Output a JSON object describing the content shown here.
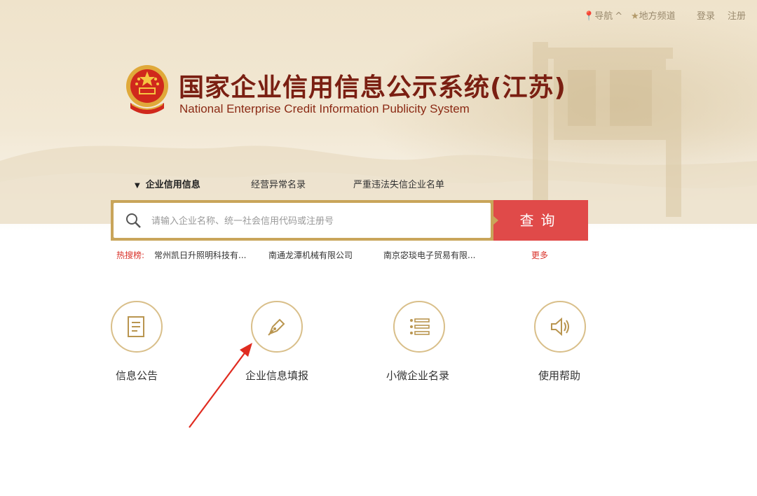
{
  "topnav": {
    "nav_label": "导航",
    "nav_chevron": "^",
    "local_label": "地方频道",
    "login": "登录",
    "register": "注册",
    "pin_icon": "location-pin",
    "star_icon": "star"
  },
  "header": {
    "title_cn": "国家企业信用信息公示系统(江苏)",
    "title_en": "National Enterprise Credit Information Publicity System",
    "emblem_icon": "national-emblem"
  },
  "tabs": [
    {
      "label": "企业信用信息",
      "active": true,
      "marker": "▼"
    },
    {
      "label": "经营异常名录",
      "active": false
    },
    {
      "label": "严重违法失信企业名单",
      "active": false
    }
  ],
  "search": {
    "placeholder": "请输入企业名称、统一社会信用代码或注册号",
    "button_label": "查询",
    "icon": "search-icon"
  },
  "hot": {
    "label": "热搜榜:",
    "items": [
      "常州凯日升照明科技有...",
      "南通龙潭机械有限公司",
      "南京宓琰电子贸易有限..."
    ],
    "more": "更多"
  },
  "features": [
    {
      "label": "信息公告",
      "icon": "document-icon"
    },
    {
      "label": "企业信息填报",
      "icon": "pen-icon"
    },
    {
      "label": "小微企业名录",
      "icon": "list-icon"
    },
    {
      "label": "使用帮助",
      "icon": "speaker-icon"
    }
  ],
  "colors": {
    "brand_red": "#e04a49",
    "title_red": "#7a1f12",
    "gold": "#c9a55a",
    "circle_border": "#d9bf8a"
  }
}
